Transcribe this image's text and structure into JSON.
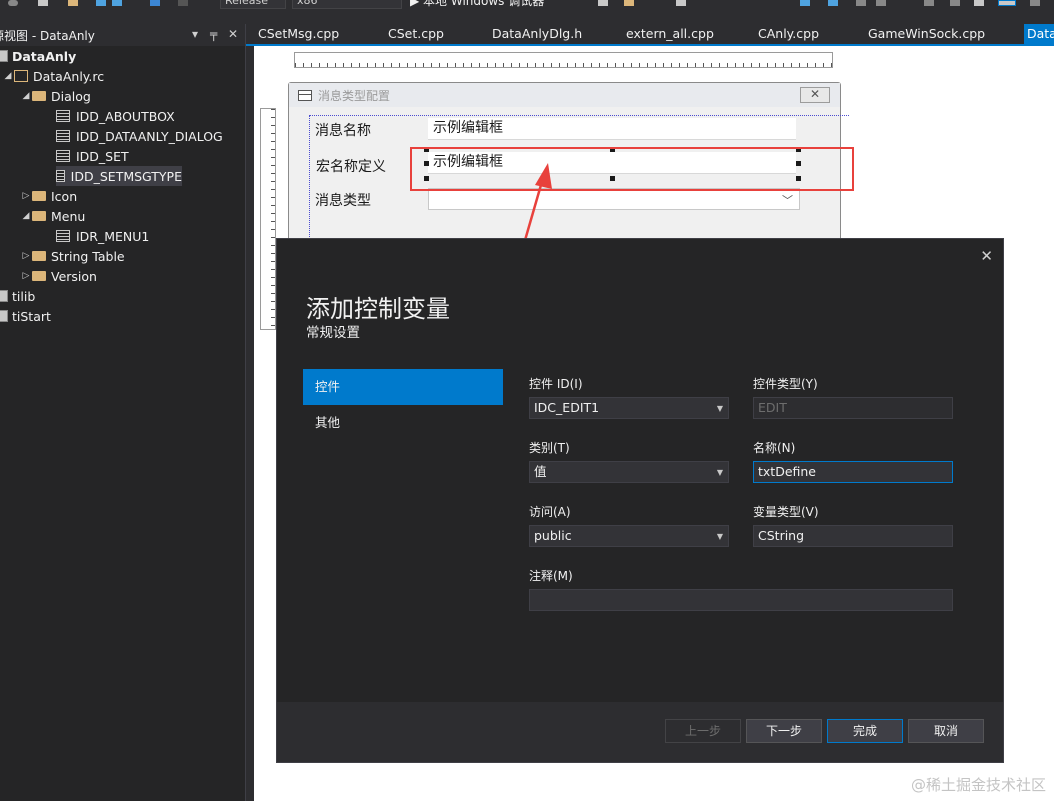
{
  "toolbar": {
    "config": "Release",
    "platform": "x86",
    "run_label": "本地 Windows 调试器"
  },
  "solution_panel": {
    "title": "源视图 - DataAnly",
    "pin": "▾ ╪ ✕",
    "items": [
      {
        "label": "DataAnly",
        "bold": true
      },
      {
        "label": "DataAnly.rc"
      },
      {
        "label": "Dialog"
      },
      {
        "label": "IDD_ABOUTBOX"
      },
      {
        "label": "IDD_DATAANLY_DIALOG"
      },
      {
        "label": "IDD_SET"
      },
      {
        "label": "IDD_SETMSGTYPE"
      },
      {
        "label": "Icon"
      },
      {
        "label": "Menu"
      },
      {
        "label": "IDR_MENU1"
      },
      {
        "label": "String Table"
      },
      {
        "label": "Version"
      },
      {
        "label": "tilib"
      },
      {
        "label": "tiStart"
      }
    ]
  },
  "tabs": [
    {
      "label": "CSetMsg.cpp"
    },
    {
      "label": "CSet.cpp"
    },
    {
      "label": "DataAnlyDlg.h"
    },
    {
      "label": "extern_all.cpp"
    },
    {
      "label": "CAnly.cpp"
    },
    {
      "label": "GameWinSock.cpp"
    },
    {
      "label": "Data"
    }
  ],
  "preview_dialog": {
    "title": "消息类型配置",
    "close": "✕",
    "label_name": "消息名称",
    "edit_name": "示例编辑框",
    "label_macro": "宏名称定义",
    "edit_macro": "示例编辑框",
    "label_type": "消息类型"
  },
  "add_var_dialog": {
    "title": "添加控制变量",
    "subtitle": "常规设置",
    "close": "✕",
    "nav": [
      "控件",
      "其他"
    ],
    "fields": {
      "control_id_label": "控件 ID(I)",
      "control_id_value": "IDC_EDIT1",
      "control_type_label": "控件类型(Y)",
      "control_type_value": "EDIT",
      "category_label": "类别(T)",
      "category_value": "值",
      "name_label": "名称(N)",
      "name_value": "txtDefine",
      "access_label": "访问(A)",
      "access_value": "public",
      "var_type_label": "变量类型(V)",
      "var_type_value": "CString",
      "comment_label": "注释(M)",
      "comment_value": ""
    },
    "buttons": {
      "prev": "上一步",
      "next": "下一步",
      "finish": "完成",
      "cancel": "取消"
    }
  },
  "watermark": "@稀土掘金技术社区",
  "colors": {
    "accent": "#007acc",
    "annotation": "#e8413c"
  }
}
